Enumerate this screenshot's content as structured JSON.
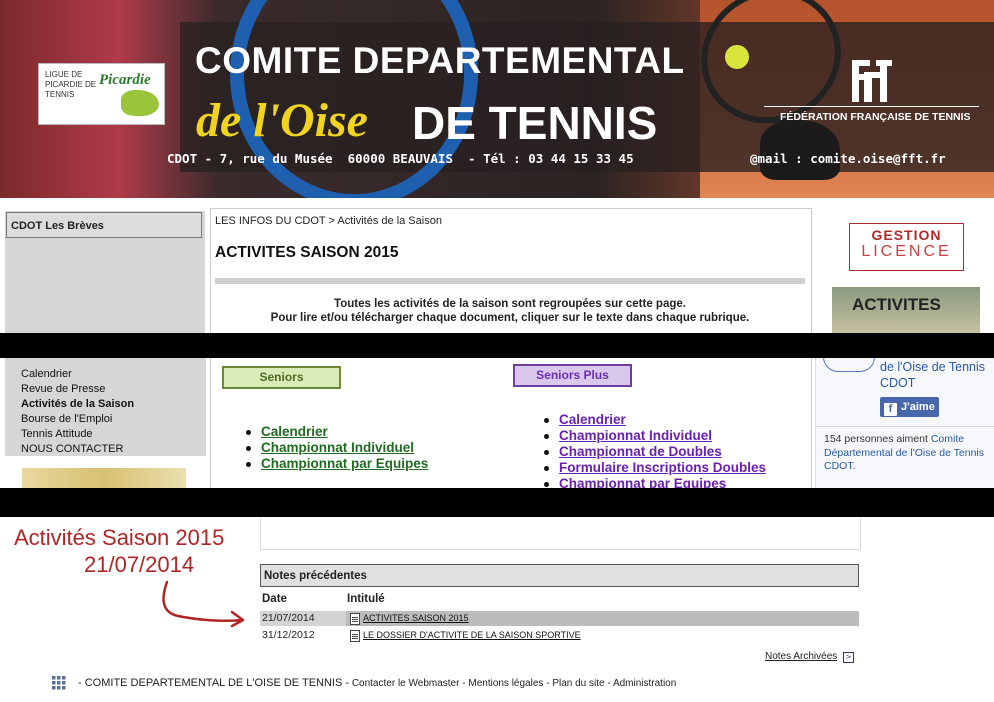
{
  "banner": {
    "logo_text": "LIGUE DE PICARDIE DE TENNIS",
    "logo_script": "Picardie",
    "title_line1": "COMITE DEPARTEMENTAL",
    "title_line2_script": "de l'Oise",
    "title_line2_bold": "DE TENNIS",
    "address": "CDOT - 7, rue du Musée  60000 BEAUVAIS  - Tél : 03 44 15 33 45",
    "email": "@mail : comite.oise@fft.fr",
    "fft_text": "FÉDÉRATION FRANÇAISE DE TENNIS"
  },
  "left_sidebar": {
    "title": "CDOT Les Brèves",
    "menu": [
      "Calendrier",
      "Revue de Presse",
      "Activités de la Saison",
      "Bourse de l'Emploi",
      "Tennis Attitude",
      "NOUS CONTACTER"
    ]
  },
  "main": {
    "breadcrumb_root": "LES INFOS DU CDOT",
    "breadcrumb_sep": ">",
    "breadcrumb_current": "Activités de la Saison",
    "page_title": "ACTIVITES SAISON 2015",
    "intro_line1": "Toutes les activités de la saison sont regroupées sur cette page.",
    "intro_line2": "Pour lire et/ou télécharger chaque document, cliquer sur le texte dans chaque rubrique.",
    "seniors_label": "Seniors",
    "seniors_plus_label": "Seniors Plus",
    "seniors_links": [
      "Calendrier ",
      "Championnat Individuel",
      "Championnat par Equipes"
    ],
    "seniors_plus_links": [
      "Calendrier",
      "Championnat Individuel",
      "Championnat de Doubles",
      "Formulaire Inscriptions Doubles",
      "Championnat par Equipes"
    ]
  },
  "right_sidebar": {
    "gestion_line1": "GESTION",
    "gestion_line2": "LICENCE",
    "activites_img_text": "ACTIVITES",
    "fb_page_name": "de l'Oise de Tennis CDOT",
    "fb_like": "J'aime",
    "fb_count_text": "154 personnes aiment",
    "fb_count_link": "Comite Départemental de l'Oise de Tennis CDOT."
  },
  "annotation": {
    "line1": "Activités Saison 2015",
    "line2": "21/07/2014"
  },
  "notes": {
    "header": "Notes précédentes",
    "col_date": "Date",
    "col_title": "Intitulé",
    "rows": [
      {
        "date": "21/07/2014",
        "title": "ACTIVITES SAISON 2015"
      },
      {
        "date": "31/12/2012",
        "title": "LE DOSSIER D'ACTIVITE DE LA SAISON SPORTIVE"
      }
    ],
    "archives": "Notes Archivées"
  },
  "footer": {
    "org": "- COMITE DEPARTEMENTAL DE L'OISE DE TENNIS -",
    "links": [
      "Contacter le Webmaster",
      "Mentions légales",
      "Plan du site",
      "Administration"
    ],
    "sep": "-"
  },
  "colors": {
    "seniors_green": "#1f6b1f",
    "seniors_plus_purple": "#6a1fb5",
    "annotation_red": "#b02525",
    "fb_blue": "#4767aa"
  }
}
